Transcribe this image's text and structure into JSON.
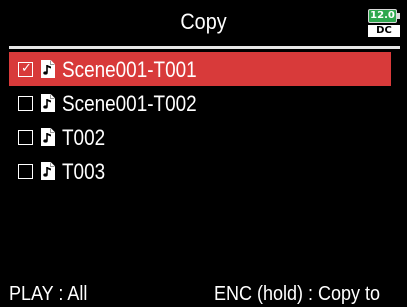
{
  "title": "Copy",
  "battery": {
    "level": "12.0",
    "source": "DC",
    "color": "#2fa84f"
  },
  "accent_color": "#d83a3a",
  "files": [
    {
      "name": "Scene001-T001",
      "checked": true,
      "selected": true,
      "icon": "audio-file-icon"
    },
    {
      "name": "Scene001-T002",
      "checked": false,
      "selected": false,
      "icon": "audio-file-icon"
    },
    {
      "name": "T002",
      "checked": false,
      "selected": false,
      "icon": "audio-file-icon"
    },
    {
      "name": "T003",
      "checked": false,
      "selected": false,
      "icon": "audio-file-icon"
    }
  ],
  "footer": {
    "left": "PLAY : All",
    "right": "ENC (hold) : Copy to"
  }
}
